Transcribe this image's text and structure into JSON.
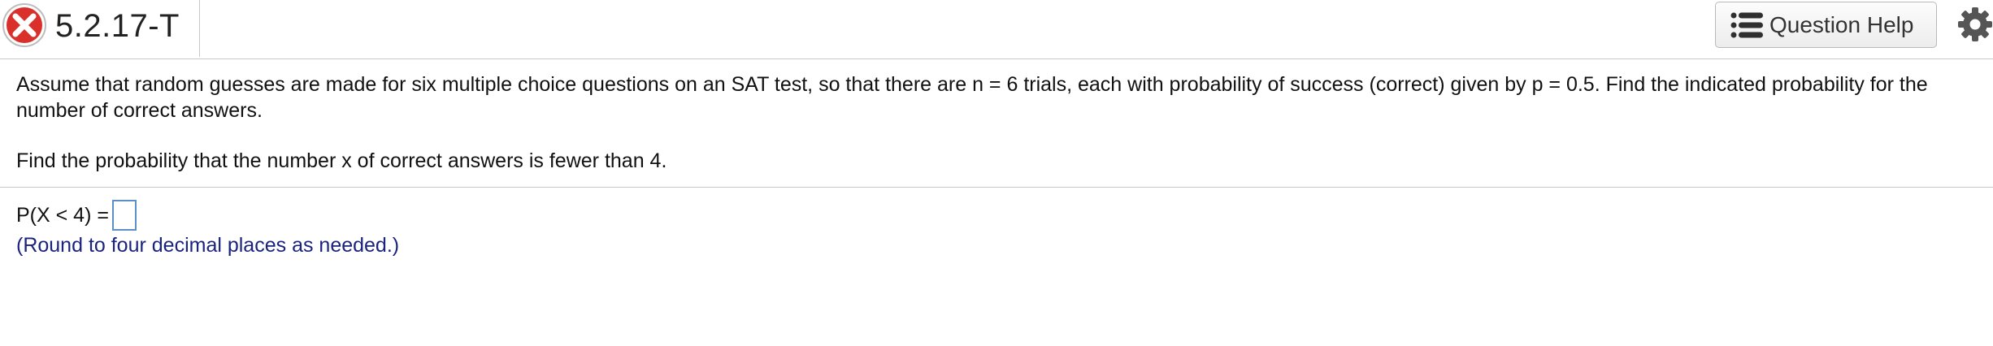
{
  "header": {
    "question_id": "5.2.17-T",
    "status_icon": "incorrect-x-icon",
    "help_label": "Question Help",
    "help_icon": "list-icon",
    "settings_icon": "gear-icon"
  },
  "question": {
    "prompt": "Assume that random guesses are made for six multiple choice questions on an SAT test, so that there are n = 6 trials, each with probability of success (correct) given by p = 0.5. Find the indicated probability for the number of correct answers.",
    "instruction": "Find the probability that the number x of correct answers is fewer than 4.",
    "answer_label": "P(X < 4) =",
    "answer_value": "",
    "note": "(Round to four decimal places as needed.)"
  },
  "colors": {
    "status_red": "#d9302b",
    "note_text": "#1a237e",
    "input_border": "#5b8fc7"
  }
}
